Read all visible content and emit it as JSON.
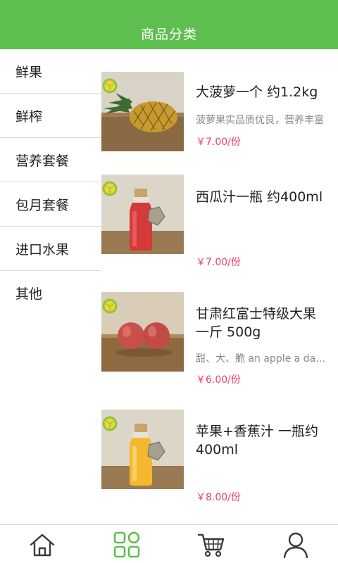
{
  "header": {
    "title": "商品分类"
  },
  "categories": [
    "鲜果",
    "鲜榨",
    "营养套餐",
    "包月套餐",
    "进口水果",
    "其他"
  ],
  "products": [
    {
      "name": "大菠萝一个 约1.2kg",
      "desc": "菠萝果实品质优良，营养丰富",
      "price": "￥7.00/份"
    },
    {
      "name": "西瓜汁一瓶 约400ml",
      "desc": "",
      "price": "￥7.00/份"
    },
    {
      "name": "甘肃红富士特级大果 一斤 500g",
      "desc": "甜、大、脆 an apple a day keeps the doctor away",
      "price": "￥6.00/份"
    },
    {
      "name": "苹果+香蕉汁 一瓶约400ml",
      "desc": "",
      "price": "￥8.00/份"
    }
  ],
  "tabs": [
    "home-icon",
    "category-grid-icon",
    "cart-icon",
    "user-icon"
  ],
  "colors": {
    "brand": "#5dbf4e",
    "price": "#ea3f6b",
    "tab_inactive": "#3a3a3a"
  }
}
